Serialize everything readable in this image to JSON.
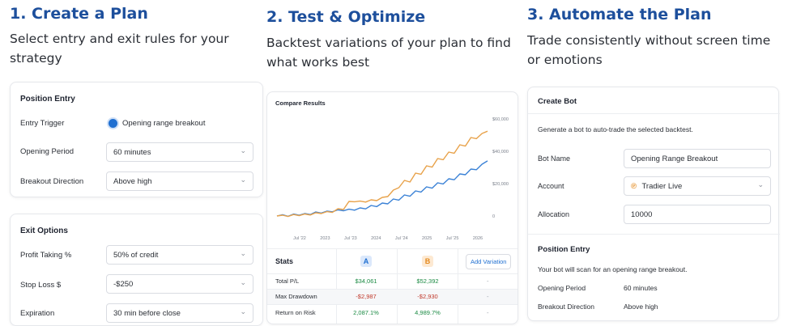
{
  "col1": {
    "title": "1. Create a Plan",
    "subtitle": "Select entry and exit rules for your strategy",
    "entry_card": {
      "title": "Position Entry",
      "trigger_label": "Entry Trigger",
      "trigger_value": "Opening range breakout",
      "period_label": "Opening Period",
      "period_value": "60 minutes",
      "direction_label": "Breakout Direction",
      "direction_value": "Above high"
    },
    "exit_card": {
      "title": "Exit Options",
      "profit_label": "Profit Taking %",
      "profit_value": "50% of credit",
      "stop_label": "Stop Loss $",
      "stop_value": "-$250",
      "expiration_label": "Expiration",
      "expiration_value": "30 min before close"
    }
  },
  "col2": {
    "title": "2. Test & Optimize",
    "subtitle": "Backtest variations of your plan to find what works best",
    "compare_title": "Compare Results",
    "stats": {
      "header": "Stats",
      "badge_a": "A",
      "badge_b": "B",
      "add_variation": "Add Variation",
      "rows": [
        {
          "label": "Total P/L",
          "a": "$34,061",
          "b": "$52,392",
          "c": "-"
        },
        {
          "label": "Max Drawdown",
          "a": "-$2,987",
          "b": "-$2,930",
          "c": "-"
        },
        {
          "label": "Return on Risk",
          "a": "2,087.1%",
          "b": "4,989.7%",
          "c": "-"
        }
      ]
    }
  },
  "col3": {
    "title": "3. Automate the Plan",
    "subtitle": "Trade consistently without screen time or emotions",
    "bot_card": {
      "title": "Create Bot",
      "description": "Generate a bot to auto-trade the selected backtest.",
      "name_label": "Bot Name",
      "name_value": "Opening Range Breakout",
      "account_label": "Account",
      "account_value": "Tradier Live",
      "allocation_label": "Allocation",
      "allocation_value": "10000"
    },
    "entry_section": {
      "title": "Position Entry",
      "description": "Your bot will scan for an opening range breakout.",
      "period_label": "Opening Period",
      "period_value": "60 minutes",
      "direction_label": "Breakout Direction",
      "direction_value": "Above high"
    }
  },
  "chart_data": {
    "type": "line",
    "title": "Compare Results",
    "x_tick_labels": [
      "Jul '22",
      "2023",
      "Jul '23",
      "2024",
      "Jul '24",
      "2025",
      "Jul '25",
      "2026"
    ],
    "y_tick_labels": [
      "$60,000",
      "$40,000",
      "$20,000",
      "0"
    ],
    "ylim": [
      -2000,
      60000
    ],
    "colors": {
      "A": "#3b82d6",
      "B": "#e8a24a"
    },
    "series": [
      {
        "name": "A",
        "values": [
          0,
          800,
          -200,
          1200,
          500,
          1500,
          900,
          2500,
          1800,
          3000,
          2600,
          3800,
          3200,
          4200,
          3600,
          5000,
          4400,
          6500,
          5800,
          8000,
          7500,
          10500,
          9800,
          13000,
          12200,
          15500,
          14800,
          18000,
          17200,
          20500,
          19800,
          23000,
          22400,
          26000,
          25500,
          29000,
          28600,
          32000,
          34061
        ]
      },
      {
        "name": "B",
        "values": [
          0,
          500,
          -300,
          900,
          200,
          1200,
          600,
          2000,
          1500,
          2700,
          2200,
          4500,
          4000,
          9000,
          8800,
          9200,
          8600,
          10000,
          9500,
          11500,
          12000,
          16000,
          17500,
          22000,
          21000,
          26500,
          25800,
          31000,
          30200,
          35500,
          34800,
          39500,
          38800,
          44000,
          43200,
          48500,
          47800,
          51000,
          52392
        ]
      }
    ]
  }
}
